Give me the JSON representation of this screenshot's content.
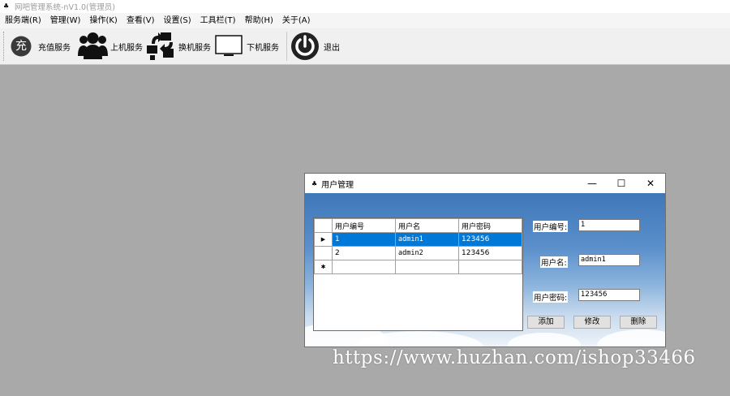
{
  "app": {
    "title": "网吧管理系统-nV1.0(管理员)",
    "icon": "app-icon"
  },
  "menu": [
    {
      "label": "服务端(R)"
    },
    {
      "label": "管理(W)"
    },
    {
      "label": "操作(K)"
    },
    {
      "label": "查看(V)"
    },
    {
      "label": "设置(S)"
    },
    {
      "label": "工具栏(T)"
    },
    {
      "label": "帮助(H)"
    },
    {
      "label": "关于(A)"
    }
  ],
  "toolbar": {
    "recharge": {
      "label": "充值服务",
      "icon": "recharge-icon",
      "glyph": "充"
    },
    "login": {
      "label": "上机服务",
      "icon": "users-icon"
    },
    "switch": {
      "label": "换机服务",
      "icon": "switch-icon"
    },
    "logout": {
      "label": "下机服务",
      "icon": "monitor-icon"
    },
    "exit": {
      "label": "退出",
      "icon": "power-icon"
    }
  },
  "dialog": {
    "title": "用户管理",
    "controls": {
      "minimize": "—",
      "maximize": "☐",
      "close": "✕"
    },
    "grid": {
      "headers": [
        "用户编号",
        "用户名",
        "用户密码"
      ],
      "rows": [
        {
          "indicator": "▶",
          "cells": [
            "1",
            "admin1",
            "123456"
          ],
          "selected": true
        },
        {
          "indicator": "",
          "cells": [
            "2",
            "admin2",
            "123456"
          ],
          "selected": false
        },
        {
          "indicator": "✱",
          "cells": [
            "",
            "",
            ""
          ],
          "selected": false
        }
      ]
    },
    "form": {
      "id_label": "用户编号:",
      "id_value": "1",
      "name_label": "用户名:",
      "name_value": "admin1",
      "password_label": "用户密码:",
      "password_value": "123456"
    },
    "buttons": {
      "add": "添加",
      "edit": "修改",
      "delete": "删除"
    }
  },
  "watermark": "https://www.huzhan.com/ishop33466"
}
